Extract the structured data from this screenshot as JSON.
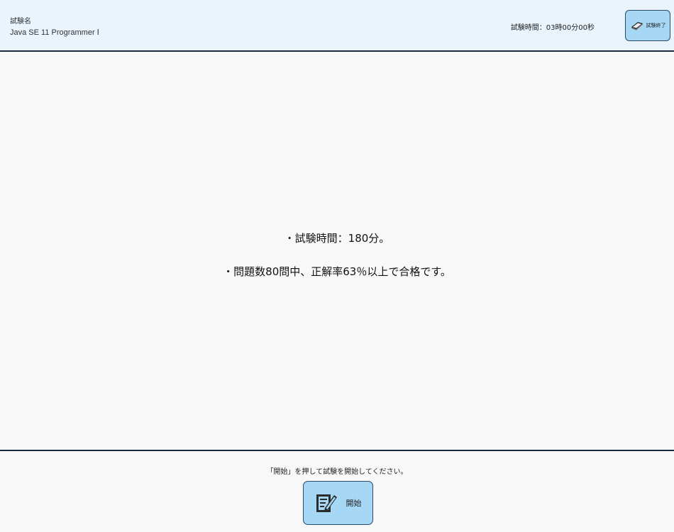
{
  "header": {
    "exam_label": "試験名",
    "exam_name": "Java SE 11 Programmer Ⅰ",
    "exam_time": "試験時間：03時00分00秒",
    "end_button_label": "試験終了",
    "end_button_icon": "book-icon"
  },
  "main": {
    "info_lines": [
      "・試験時間：180分。",
      "・問題数80問中、正解率63％以上で合格です。"
    ]
  },
  "footer": {
    "message": "「開始」を押して試験を開始してください。",
    "start_button_label": "開始",
    "start_button_icon": "edit-document-icon"
  },
  "colors": {
    "header_bg": "#eaf4fd",
    "button_bg": "#a6d8f5",
    "border": "#1b2a44"
  }
}
